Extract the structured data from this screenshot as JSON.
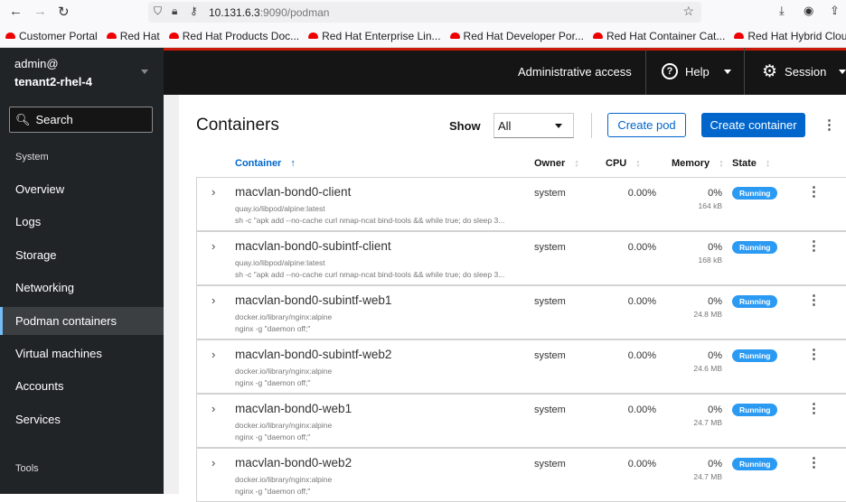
{
  "browser": {
    "url_host": "10.131.6.3",
    "url_path": ":9090/podman"
  },
  "bookmarks": [
    "Customer Portal",
    "Red Hat",
    "Red Hat Products Doc...",
    "Red Hat Enterprise Lin...",
    "Red Hat Developer Por...",
    "Red Hat Container Cat...",
    "Red Hat Hybrid Cloud ..."
  ],
  "header": {
    "user": "admin@",
    "host": "tenant2-rhel-4",
    "admin_access": "Administrative access",
    "help": "Help",
    "session": "Session"
  },
  "sidebar": {
    "search": "Search",
    "section_system": "System",
    "items": [
      "Overview",
      "Logs",
      "Storage",
      "Networking",
      "Podman containers",
      "Virtual machines",
      "Accounts",
      "Services"
    ],
    "section_tools": "Tools",
    "active": "Podman containers"
  },
  "main": {
    "title": "Containers",
    "show_label": "Show",
    "show_value": "All",
    "create_pod": "Create pod",
    "create_container": "Create container"
  },
  "table": {
    "headers": {
      "container": "Container",
      "owner": "Owner",
      "cpu": "CPU",
      "memory": "Memory",
      "state": "State"
    },
    "rows": [
      {
        "name": "macvlan-bond0-client",
        "image": "quay.io/libpod/alpine:latest",
        "command": "sh -c \"apk add --no-cache curl nmap-ncat bind-tools && while true; do sleep 3...",
        "owner": "system",
        "cpu": "0.00%",
        "mem": "0%",
        "mem_size": "164 kB",
        "state": "Running"
      },
      {
        "name": "macvlan-bond0-subintf-client",
        "image": "quay.io/libpod/alpine:latest",
        "command": "sh -c \"apk add --no-cache curl nmap-ncat bind-tools && while true; do sleep 3...",
        "owner": "system",
        "cpu": "0.00%",
        "mem": "0%",
        "mem_size": "168 kB",
        "state": "Running"
      },
      {
        "name": "macvlan-bond0-subintf-web1",
        "image": "docker.io/library/nginx:alpine",
        "command": "nginx -g \"daemon off;\"",
        "owner": "system",
        "cpu": "0.00%",
        "mem": "0%",
        "mem_size": "24.8 MB",
        "state": "Running"
      },
      {
        "name": "macvlan-bond0-subintf-web2",
        "image": "docker.io/library/nginx:alpine",
        "command": "nginx -g \"daemon off;\"",
        "owner": "system",
        "cpu": "0.00%",
        "mem": "0%",
        "mem_size": "24.6 MB",
        "state": "Running"
      },
      {
        "name": "macvlan-bond0-web1",
        "image": "docker.io/library/nginx:alpine",
        "command": "nginx -g \"daemon off;\"",
        "owner": "system",
        "cpu": "0.00%",
        "mem": "0%",
        "mem_size": "24.7 MB",
        "state": "Running"
      },
      {
        "name": "macvlan-bond0-web2",
        "image": "docker.io/library/nginx:alpine",
        "command": "nginx -g \"daemon off;\"",
        "owner": "system",
        "cpu": "0.00%",
        "mem": "0%",
        "mem_size": "24.7 MB",
        "state": "Running"
      }
    ]
  }
}
